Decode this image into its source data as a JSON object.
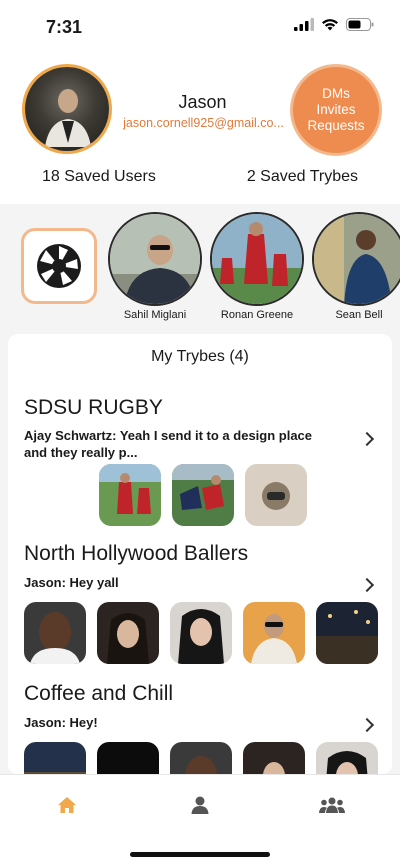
{
  "status_bar": {
    "time": "7:31"
  },
  "profile": {
    "name": "Jason",
    "email": "jason.cornell925@gmail.co...",
    "dm_button": {
      "line1": "DMs",
      "line2": "Invites",
      "line3": "Requests"
    },
    "saved_users": "18 Saved Users",
    "saved_trybes": "2 Saved Trybes"
  },
  "stories": [
    {
      "name": "Sahil Miglani"
    },
    {
      "name": "Ronan Greene"
    },
    {
      "name": "Sean Bell"
    }
  ],
  "my_trybes": {
    "title": "My Trybes (4)",
    "items": [
      {
        "name": "SDSU RUGBY",
        "message": "Ajay Schwartz: Yeah I send it to a design place and they really p..."
      },
      {
        "name": "North Hollywood Ballers",
        "message": "Jason: Hey yall"
      },
      {
        "name": "Coffee and Chill",
        "message": "Jason: Hey!"
      }
    ]
  },
  "tabs": [
    {
      "icon": "home-icon"
    },
    {
      "icon": "person-icon"
    },
    {
      "icon": "group-icon"
    }
  ],
  "colors": {
    "accent": "#ee8b4f",
    "accent_light": "#f3b98d",
    "active_tab": "#f0a84a",
    "inactive_tab": "#555555"
  }
}
